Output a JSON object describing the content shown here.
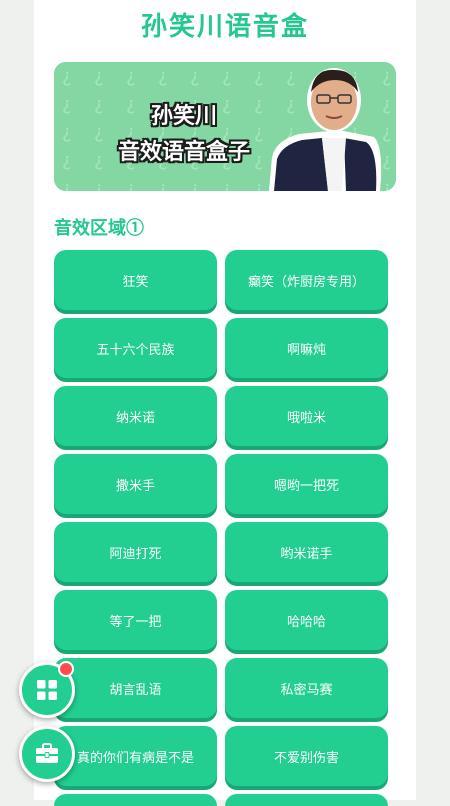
{
  "header": {
    "title": "孙笑川语音盒"
  },
  "banner": {
    "line1": "孙笑川",
    "line2": "音效语音盒子"
  },
  "section": {
    "title": "音效区域①"
  },
  "buttons": [
    "狂笑",
    "癫笑（炸厨房专用）",
    "五十六个民族",
    "啊嘛炖",
    "纳米诺",
    "哦啦米",
    "撒米手",
    "嗯哟一把死",
    "阿迪打死",
    "哟米诺手",
    "等了一把",
    "哈哈哈",
    "胡言乱语",
    "私密马赛",
    "真的你们有病是不是",
    "不爱别伤害"
  ],
  "fabs": [
    {
      "icon": "grid-apps-icon",
      "has_badge": true
    },
    {
      "icon": "toolbox-icon",
      "has_badge": false
    }
  ],
  "colors": {
    "accent": "#22cf90",
    "title": "#24c78f",
    "badge": "#ff4d4f"
  }
}
